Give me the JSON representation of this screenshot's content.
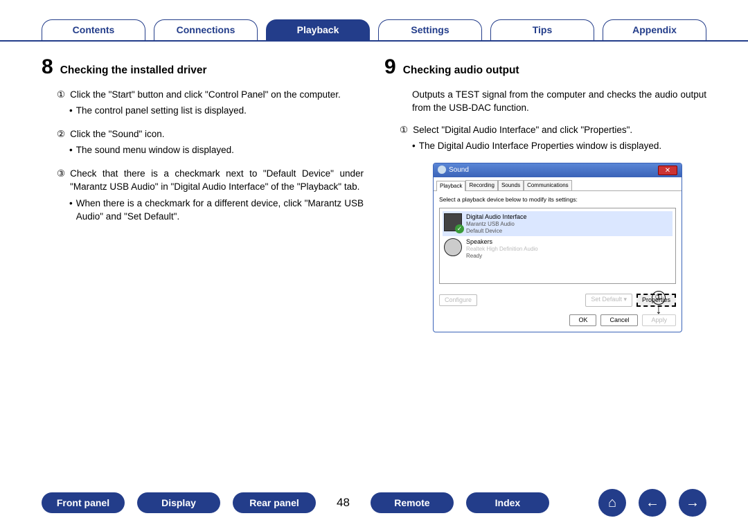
{
  "tabs": {
    "contents": "Contents",
    "connections": "Connections",
    "playback": "Playback",
    "settings": "Settings",
    "tips": "Tips",
    "appendix": "Appendix"
  },
  "left": {
    "num": "8",
    "title": "Checking the installed driver",
    "i1_c": "①",
    "i1": "Click the \"Start\" button and click \"Control Panel\" on the computer.",
    "i1b": "The control panel setting list is displayed.",
    "i2_c": "②",
    "i2": "Click the \"Sound\" icon.",
    "i2b": "The sound menu window is displayed.",
    "i3_c": "③",
    "i3": "Check that there is a checkmark next to \"Default Device\" under \"Marantz USB Audio\" in \"Digital Audio Interface\" of the \"Playback\" tab.",
    "i3b": "When there is a checkmark for a different device, click \"Marantz USB Audio\" and \"Set Default\"."
  },
  "right": {
    "num": "9",
    "title": "Checking audio output",
    "intro": "Outputs a TEST signal from the computer and checks the audio output from the USB-DAC function.",
    "i1_c": "①",
    "i1": "Select \"Digital Audio Interface\" and click \"Properties\".",
    "i1b": "The Digital Audio Interface Properties window is displayed."
  },
  "dialog": {
    "title": "Sound",
    "close": "✕",
    "tab_playback": "Playback",
    "tab_recording": "Recording",
    "tab_sounds": "Sounds",
    "tab_comm": "Communications",
    "hint": "Select a playback device below to modify its settings:",
    "dev1_t1": "Digital Audio Interface",
    "dev1_t2": "Marantz USB Audio",
    "dev1_t3": "Default Device",
    "check": "✓",
    "dev2_t1": "Speakers",
    "dev2_t2": "Realtek High Definition Audio",
    "dev2_t3": "Ready",
    "configure": "Configure",
    "set_default": "Set Default  ▾",
    "properties": "Properties",
    "ok": "OK",
    "cancel": "Cancel",
    "apply": "Apply"
  },
  "callout": {
    "num": "①",
    "arrow": "↓"
  },
  "bottom": {
    "front": "Front panel",
    "display": "Display",
    "rear": "Rear panel",
    "page": "48",
    "remote": "Remote",
    "index": "Index",
    "home": "⌂",
    "prev": "←",
    "next": "→"
  }
}
